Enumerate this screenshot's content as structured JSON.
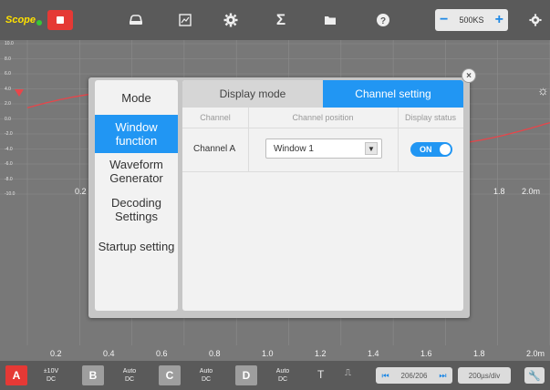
{
  "app": {
    "logo_text": "Scope"
  },
  "toolbar": {
    "icons": [
      "stop-icon",
      "car-icon",
      "report-icon",
      "gear-icon",
      "sigma-icon",
      "folder-icon",
      "help-icon",
      "settings-icon"
    ],
    "sample_rate": "500KS"
  },
  "graph": {
    "x_ticks": [
      "0.2",
      "0.4",
      "0.6",
      "0.8",
      "1.0",
      "1.2",
      "1.4",
      "1.6",
      "1.8",
      "2.0m"
    ],
    "inner_x_ticks": [
      "0.2",
      "1.8",
      "2.0m"
    ],
    "y_ticks": [
      "10.0",
      "8.0",
      "6.0",
      "4.0",
      "2.0",
      "0.0",
      "-2.0",
      "-4.0",
      "-6.0",
      "-8.0",
      "-10.0"
    ],
    "trace_color": "#e8454a",
    "grid_color": "#8c8c8c"
  },
  "dialog": {
    "menu": [
      {
        "label": "Mode",
        "active": false
      },
      {
        "label": "Window function",
        "active": true
      },
      {
        "label": "Waveform Generator",
        "active": false
      },
      {
        "label": "Decoding Settings",
        "active": false
      },
      {
        "label": "Startup setting",
        "active": false
      }
    ],
    "tabs": {
      "display_mode": "Display mode",
      "channel_setting": "Channel setting"
    },
    "table": {
      "headers": {
        "channel": "Channel",
        "position": "Channel position",
        "status": "Display status"
      },
      "row": {
        "channel": "Channel A",
        "position": "Window 1",
        "status": "ON"
      }
    },
    "close_glyph": "×"
  },
  "bottombar": {
    "channels": [
      {
        "label": "A",
        "meta": "±10V\nDC",
        "color": "#e53935"
      },
      {
        "label": "B",
        "meta": "Auto\nDC",
        "color": "#9e9e9e"
      },
      {
        "label": "C",
        "meta": "Auto\nDC",
        "color": "#9e9e9e"
      },
      {
        "label": "D",
        "meta": "Auto\nDC",
        "color": "#9e9e9e"
      }
    ],
    "frames": "206/206",
    "timebase": "200µs/div"
  },
  "colors": {
    "accent": "#2196f3",
    "stop": "#e53935",
    "toolbar": "#5a5a5a"
  }
}
